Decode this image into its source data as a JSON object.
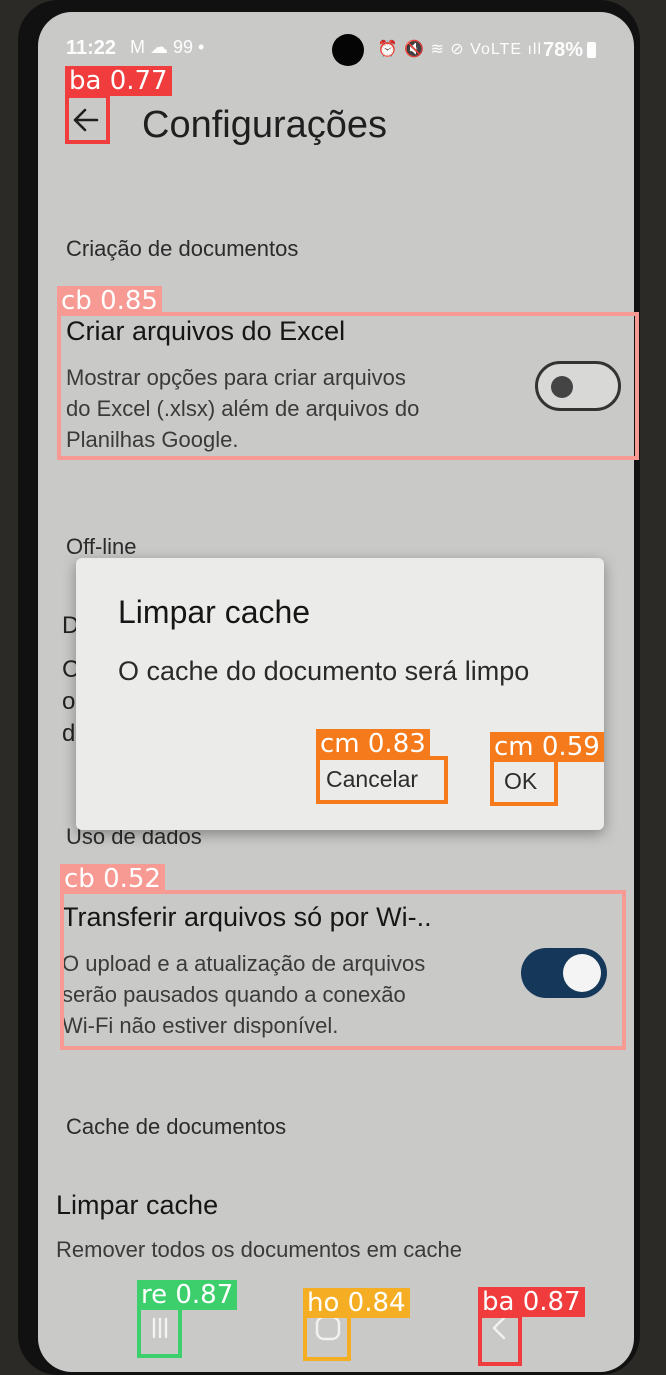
{
  "status_bar": {
    "time": "11:22",
    "left_icons": "M ☁ 99 •",
    "right_icons": "⏰ 🔇 ≋ ⊘ VoLTE ıll",
    "battery": "78%"
  },
  "app_bar": {
    "back_icon": "arrow-left-icon",
    "title": "Configurações"
  },
  "sections": {
    "doc_creation": "Criação de documentos",
    "offline": "Off-line",
    "data_usage": "Uso de dados",
    "doc_cache": "Cache de documentos"
  },
  "excel_pref": {
    "title": "Criar arquivos do Excel",
    "desc_1": "Mostrar opções para criar arquivos",
    "desc_2": "do Excel (.xlsx) além de arquivos do",
    "desc_3": "Planilhas Google.",
    "enabled": false
  },
  "offline_partial": {
    "l1": "D",
    "l2": "C",
    "l3": "o",
    "l4": "d"
  },
  "wifi_pref": {
    "title": "Transferir arquivos só por Wi-..",
    "desc_1": "O upload e a atualização de arquivos",
    "desc_2": "serão pausados quando a conexão",
    "desc_3": "Wi-Fi não estiver disponível.",
    "enabled": true
  },
  "clear_cache_pref": {
    "title": "Limpar cache",
    "desc": "Remover todos os documentos em cache"
  },
  "dialog": {
    "title": "Limpar cache",
    "message": "O cache do documento será limpo",
    "cancel": "Cancelar",
    "ok": "OK"
  },
  "nav_bar": {
    "recents_icon": "recents-icon",
    "home_icon": "home-icon",
    "back_icon": "chevron-left-icon"
  },
  "detections": {
    "back_top": "ba 0.77",
    "excel_toggle": "cb 0.85",
    "cancel": "cm 0.83",
    "ok": "cm 0.59",
    "wifi_toggle": "cb 0.52",
    "recents": "re 0.87",
    "home": "ho 0.84",
    "back_nav": "ba 0.87"
  },
  "colors": {
    "ba": "#f03c3c",
    "cb": "#f79a93",
    "cm": "#f57a1c",
    "re": "#3dcf6c",
    "ho": "#f5ae24",
    "toggle_on": "#15385a"
  }
}
